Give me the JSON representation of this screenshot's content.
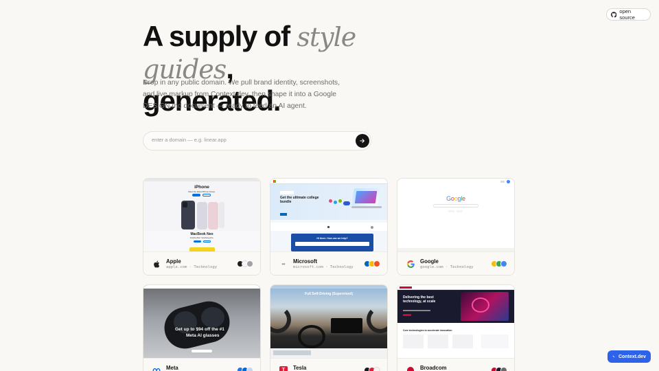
{
  "header": {
    "open_source_label": "open source"
  },
  "hero": {
    "title_a": "A supply of ",
    "title_b": "style guides",
    "title_c": ", generated.",
    "description": "Drop in any public domain. We pull brand identity, screenshots, and live markup from Context.dev, then shape it into a Google DESIGN.md document — ready to feed an AI agent."
  },
  "search": {
    "placeholder": "enter a domain — e.g. linear.app",
    "value": ""
  },
  "cards": [
    {
      "name": "Apple",
      "sub": "apple.com · Technology",
      "colors": [
        "#1d1d1f",
        "#f5f5f7",
        "#a1a1a6"
      ],
      "logo_icon": "apple-logo-icon"
    },
    {
      "name": "Microsoft",
      "sub": "microsoft.com · Technology",
      "colors": [
        "#0067b8",
        "#ffb900",
        "#f25022"
      ],
      "logo_icon": "microsoft-logo-icon"
    },
    {
      "name": "Google",
      "sub": "google.com · Technology",
      "colors": [
        "#fbbc05",
        "#34a853",
        "#4285f4"
      ],
      "logo_icon": "google-logo-icon"
    },
    {
      "name": "Meta",
      "sub": "",
      "colors": [
        "#1877f2",
        "#0064e0",
        "#c4d7f7"
      ],
      "logo_icon": "meta-logo-icon"
    },
    {
      "name": "Tesla",
      "sub": "",
      "colors": [
        "#171a20",
        "#e31937",
        "#f4f4f4"
      ],
      "logo_icon": "tesla-logo-icon"
    },
    {
      "name": "Broadcom",
      "sub": "",
      "colors": [
        "#cc092f",
        "#1a1a2e",
        "#6a6a6a"
      ],
      "logo_icon": "broadcom-logo-icon"
    }
  ],
  "screenshots": {
    "apple": {
      "heading": "iPhone",
      "tagline": "Meet the latest iPhone lineup.",
      "heading2": "MacBook Neo",
      "tagline2": "Amazing Mac. Surprising price."
    },
    "microsoft": {
      "heading": "Get the ultimate college bundle",
      "strip_text": "Hi there. How can we help?"
    },
    "google": {
      "wordmark": "Google"
    },
    "meta": {
      "headline": "Get up to $94 off the #1",
      "headline2": "Meta AI glasses"
    },
    "tesla": {
      "headline": "Full Self-Driving (Supervised)"
    },
    "broadcom": {
      "headline": "Delivering the best technology, at scale",
      "section": "Core technologies to accelerate innovation"
    }
  },
  "footer_badge": {
    "label": "Context.dev"
  }
}
